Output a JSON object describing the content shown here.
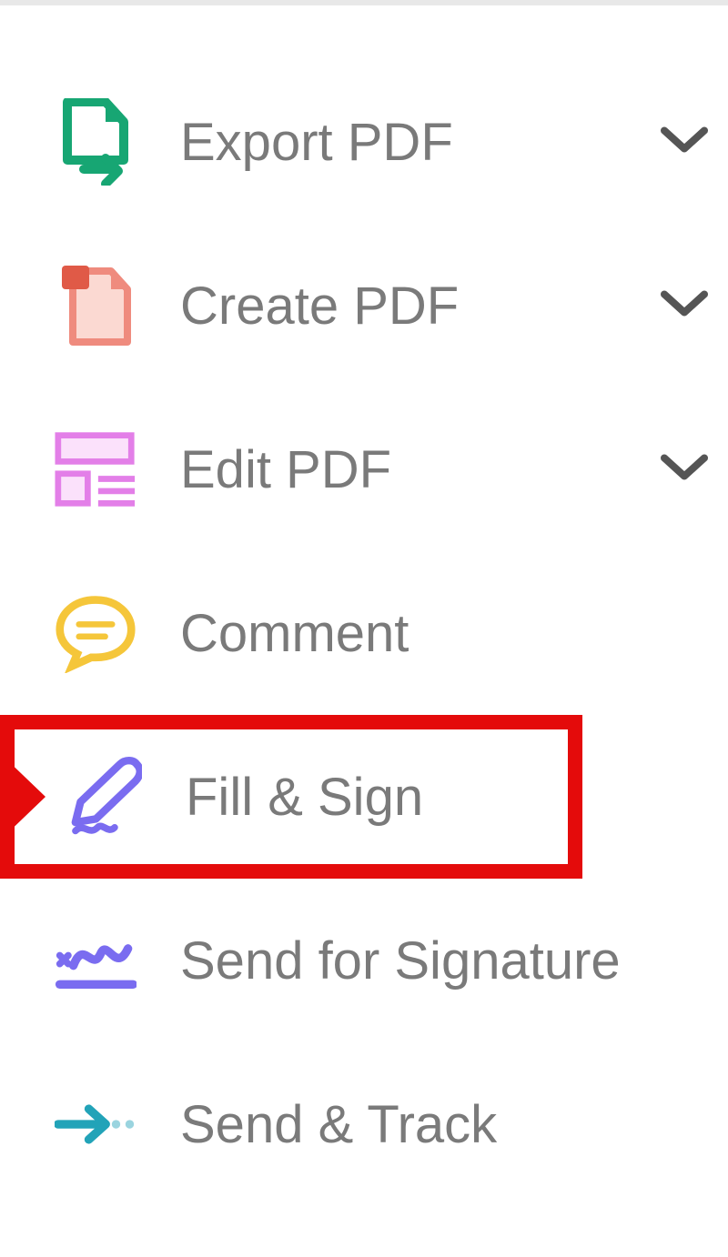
{
  "tools": {
    "items": [
      {
        "id": "export-pdf",
        "label": "Export PDF",
        "icon": "export-pdf-icon",
        "expandable": true,
        "highlighted": false
      },
      {
        "id": "create-pdf",
        "label": "Create PDF",
        "icon": "create-pdf-icon",
        "expandable": true,
        "highlighted": false
      },
      {
        "id": "edit-pdf",
        "label": "Edit PDF",
        "icon": "edit-pdf-icon",
        "expandable": true,
        "highlighted": false
      },
      {
        "id": "comment",
        "label": "Comment",
        "icon": "comment-icon",
        "expandable": false,
        "highlighted": false
      },
      {
        "id": "fill-sign",
        "label": "Fill & Sign",
        "icon": "sign-icon",
        "expandable": false,
        "highlighted": true
      },
      {
        "id": "send-sig",
        "label": "Send for Signature",
        "icon": "send-signature-icon",
        "expandable": false,
        "highlighted": false
      },
      {
        "id": "send-track",
        "label": "Send & Track",
        "icon": "send-track-icon",
        "expandable": false,
        "highlighted": false
      }
    ]
  },
  "colors": {
    "highlight": "#e40b0b",
    "text": "#7a7a7a",
    "iconGreen": "#17a673",
    "iconSalmon": "#ef8b7e",
    "iconMagenta": "#e37fe8",
    "iconYellow": "#f5c63a",
    "iconPurple": "#7a6cf0",
    "iconTeal": "#22a3b8"
  }
}
